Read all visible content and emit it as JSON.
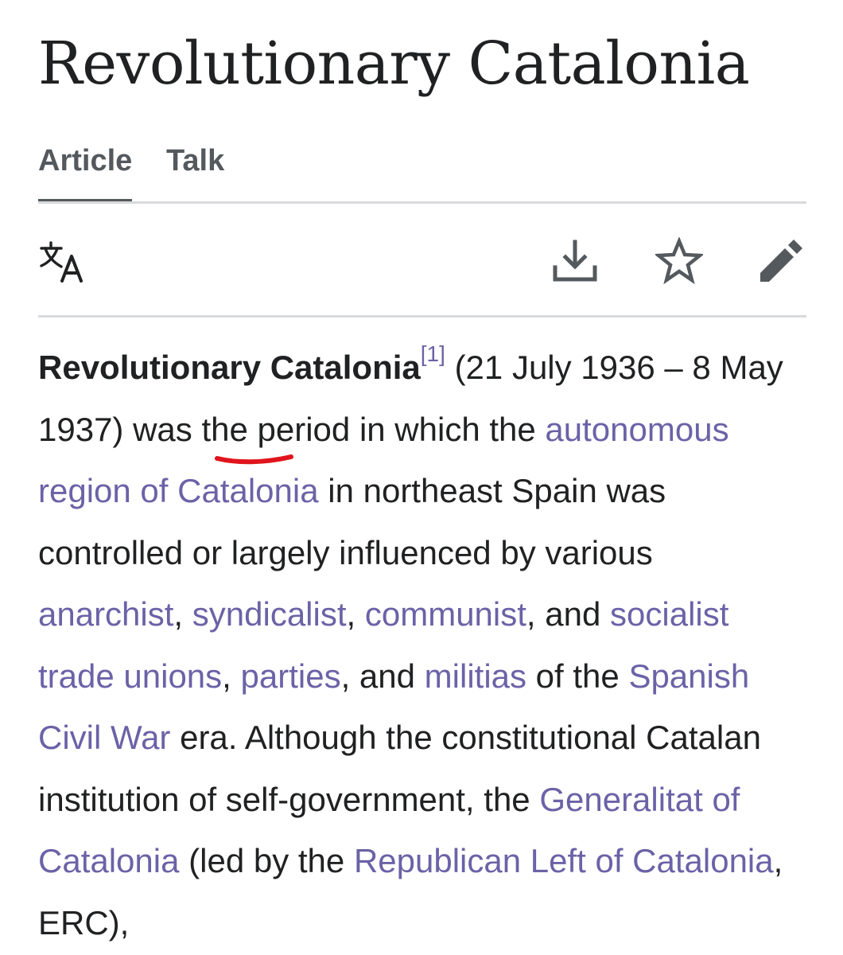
{
  "article": {
    "title": "Revolutionary Catalonia"
  },
  "tabs": [
    {
      "label": "Article",
      "active": true
    },
    {
      "label": "Talk",
      "active": false
    }
  ],
  "toolbar": {
    "icons": [
      "language-icon",
      "download-icon",
      "star-icon",
      "edit-pencil-icon"
    ]
  },
  "content": {
    "bold_title": "Revolutionary Catalonia",
    "ref": "[1]",
    "t1": " (21 July 1936 – 8 May 1937) ",
    "was": "was",
    "t2": " the period in which the ",
    "link_autonomous": "autonomous region of Catalonia",
    "t3": " in northeast Spain was controlled or largely influenced by various ",
    "link_anarchist": "anarchist",
    "t4": ", ",
    "link_syndicalist": "syndicalist",
    "t5": ", ",
    "link_communist": "communist",
    "t6": ", and ",
    "link_socialist": "socialist trade unions",
    "t7": ", ",
    "link_parties": "parties",
    "t8": ", and ",
    "link_militias": "militias",
    "t9": " of the ",
    "link_civil_war": "Spanish Civil War",
    "t10": " era. Although the constitutional Catalan institution of self-government, the ",
    "link_generalitat": "Generalitat of Catalonia",
    "t11": " (led by the ",
    "link_erc": "Republican Left of Catalonia",
    "t12": ", ERC),"
  },
  "colors": {
    "link": "#6b62a7",
    "text": "#202122",
    "tab": "#54595d",
    "divider": "#d9dadc",
    "annotation": "#e0141c"
  }
}
